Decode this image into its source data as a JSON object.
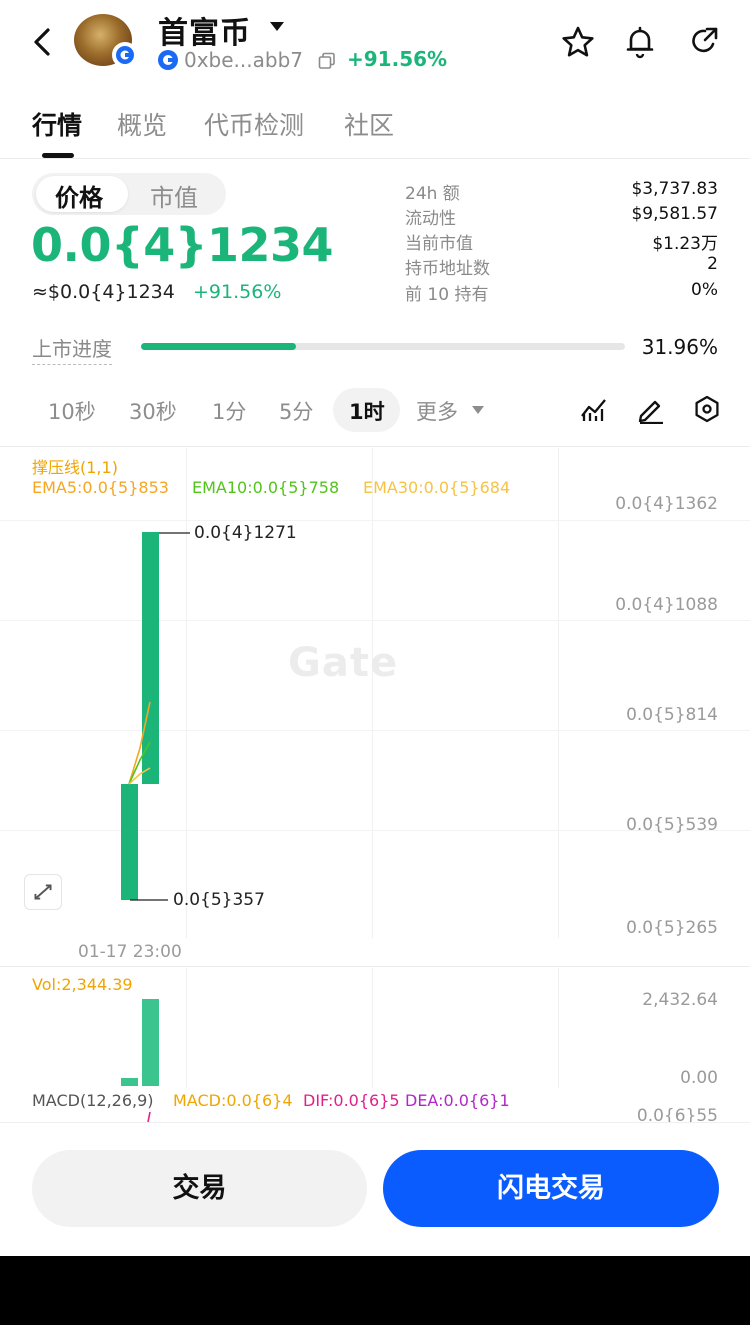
{
  "header": {
    "coin_name": "首富币",
    "address": "0xbe...abb7",
    "change": "+91.56%"
  },
  "tabs": [
    "行情",
    "概览",
    "代币检测",
    "社区"
  ],
  "price_toggle": {
    "price": "价格",
    "market_cap": "市值"
  },
  "price": {
    "main": "0.0{4}1234",
    "usd": "≈$0.0{4}1234",
    "change": "+91.56%"
  },
  "stats": [
    {
      "label": "24h 额",
      "value": "$3,737.83"
    },
    {
      "label": "流动性",
      "value": "$9,581.57"
    },
    {
      "label": "当前市值",
      "value": "$1.23万"
    },
    {
      "label": "持币地址数",
      "value": "2"
    },
    {
      "label": "前 10 持有",
      "value": "0%"
    }
  ],
  "progress": {
    "label": "上市进度",
    "value_text": "31.96%",
    "fraction": 0.3196
  },
  "intervals": [
    "10秒",
    "30秒",
    "1分",
    "5分",
    "1时",
    "更多"
  ],
  "selected_interval": "1时",
  "chart": {
    "indicator_title": "撑压线(1,1)",
    "ema5": "EMA5:0.0{5}853",
    "ema10": "EMA10:0.0{5}758",
    "ema30": "EMA30:0.0{5}684",
    "y_ticks": [
      "0.0{4}1362",
      "0.0{4}1088",
      "0.0{5}814",
      "0.0{5}539",
      "0.0{5}265"
    ],
    "high_label": "0.0{4}1271",
    "low_label": "0.0{5}357",
    "time_label": "01-17 23:00",
    "watermark": "Gate",
    "volume_label": "Vol:2,344.39",
    "vol_ticks": [
      "2,432.64",
      "0.00"
    ],
    "macd": {
      "title": "MACD(12,26,9)",
      "macd": "MACD:0.0{6}4",
      "dif": "DIF:0.0{6}5",
      "dea": "DEA:0.0{6}1",
      "tick": "0.0{6}55"
    }
  },
  "colors": {
    "up": "#1bb57a",
    "accent": "#0b5cff",
    "ema5": "#f5a623",
    "ema10": "#52c41a",
    "ema30": "#f6c343",
    "dif": "#e0208a",
    "dea": "#b227c9"
  },
  "buttons": {
    "trade": "交易",
    "flash_trade": "闪电交易"
  }
}
